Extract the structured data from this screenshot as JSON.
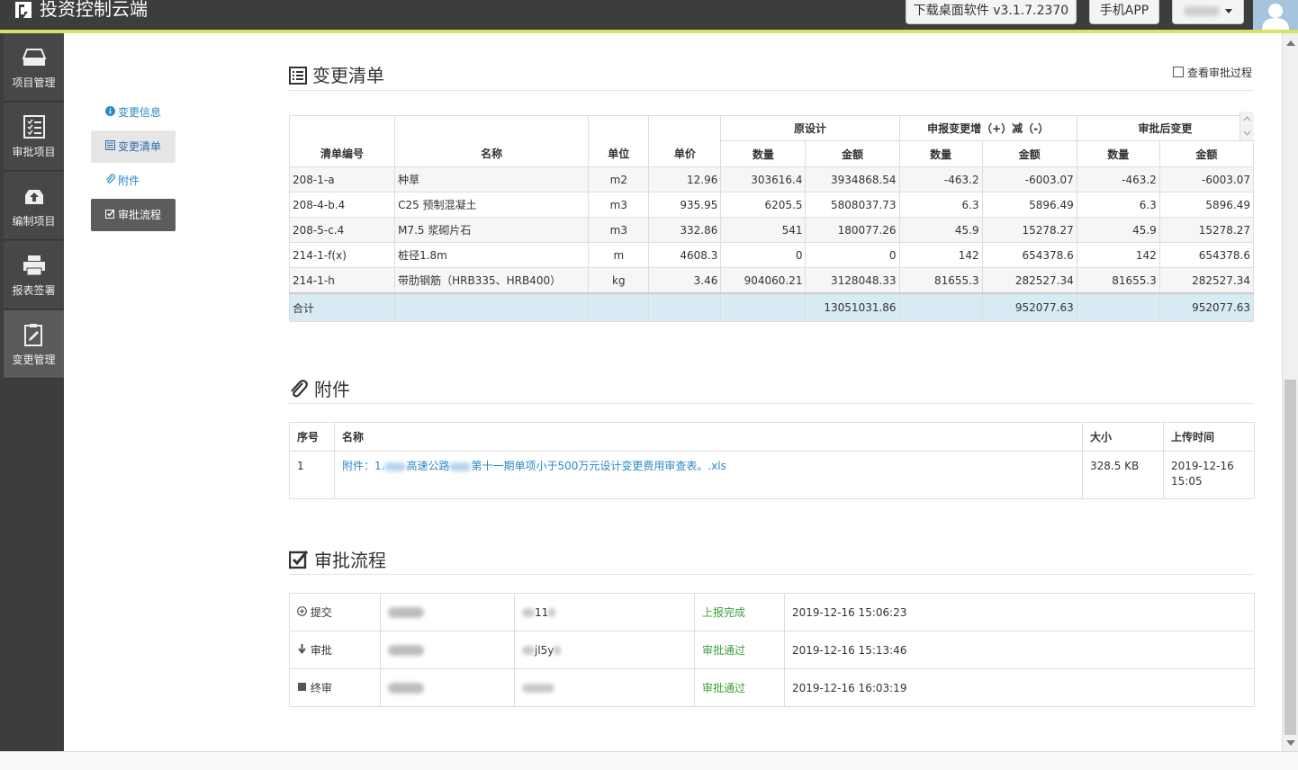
{
  "app": {
    "title": "投资控制云端",
    "download_label": "下载桌面软件 v3.1.7.2370",
    "mobile_label": "手机APP"
  },
  "sidebar": {
    "items": [
      {
        "label": "项目管理",
        "icon": "folder-tray-icon"
      },
      {
        "label": "审批项目",
        "icon": "checklist-icon"
      },
      {
        "label": "编制项目",
        "icon": "upload-tray-icon"
      },
      {
        "label": "报表签署",
        "icon": "printer-icon"
      },
      {
        "label": "变更管理",
        "icon": "clipboard-edit-icon"
      }
    ]
  },
  "leftnav": {
    "info": "变更信息",
    "list": "变更清单",
    "attach": "附件",
    "flow": "审批流程"
  },
  "bq": {
    "title": "变更清单",
    "check_label": "查看审批过程",
    "headers": {
      "code": "清单编号",
      "name": "名称",
      "unit": "单位",
      "price": "单价",
      "orig": "原设计",
      "change": "申报变更增（+）减（-）",
      "after": "审批后变更",
      "qty": "数量",
      "amount": "金额"
    },
    "rows": [
      {
        "code": "208-1-a",
        "name": "种草",
        "unit": "m2",
        "price": "12.96",
        "oq": "303616.4",
        "oa": "3934868.54",
        "cq": "-463.2",
        "ca": "-6003.07",
        "aq": "-463.2",
        "aa": "-6003.07"
      },
      {
        "code": "208-4-b.4",
        "name": "C25 预制混凝土",
        "unit": "m3",
        "price": "935.95",
        "oq": "6205.5",
        "oa": "5808037.73",
        "cq": "6.3",
        "ca": "5896.49",
        "aq": "6.3",
        "aa": "5896.49"
      },
      {
        "code": "208-5-c.4",
        "name": "M7.5 浆砌片石",
        "unit": "m3",
        "price": "332.86",
        "oq": "541",
        "oa": "180077.26",
        "cq": "45.9",
        "ca": "15278.27",
        "aq": "45.9",
        "aa": "15278.27"
      },
      {
        "code": "214-1-f(x)",
        "name": "桩径1.8m",
        "unit": "m",
        "price": "4608.3",
        "oq": "0",
        "oa": "0",
        "cq": "142",
        "ca": "654378.6",
        "aq": "142",
        "aa": "654378.6"
      },
      {
        "code": "214-1-h",
        "name": "带肋钢筋（HRB335、HRB400）",
        "unit": "kg",
        "price": "3.46",
        "oq": "904060.21",
        "oa": "3128048.33",
        "cq": "81655.3",
        "ca": "282527.34",
        "aq": "81655.3",
        "aa": "282527.34"
      }
    ],
    "total": {
      "label": "合计",
      "oa": "13051031.86",
      "ca": "952077.63",
      "aa": "952077.63"
    }
  },
  "attach": {
    "title": "附件",
    "headers": {
      "no": "序号",
      "name": "名称",
      "size": "大小",
      "time": "上传时间"
    },
    "rows": [
      {
        "no": "1",
        "name_a": "附件：1.",
        "name_b": "高速公路",
        "name_c": "第十一期单项小于500万元设计变更费用审查表。.xls",
        "size": "328.5 KB",
        "date": "2019-12-16",
        "clock": "15:05"
      }
    ]
  },
  "flow": {
    "title": "审批流程",
    "rows": [
      {
        "action": "提交",
        "acct": "11",
        "status": "上报完成",
        "time": "2019-12-16 15:06:23"
      },
      {
        "action": "审批",
        "acct": "jl5y",
        "status": "审批通过",
        "time": "2019-12-16 15:13:46"
      },
      {
        "action": "终审",
        "acct": "",
        "status": "审批通过",
        "time": "2019-12-16 16:03:19"
      }
    ]
  }
}
